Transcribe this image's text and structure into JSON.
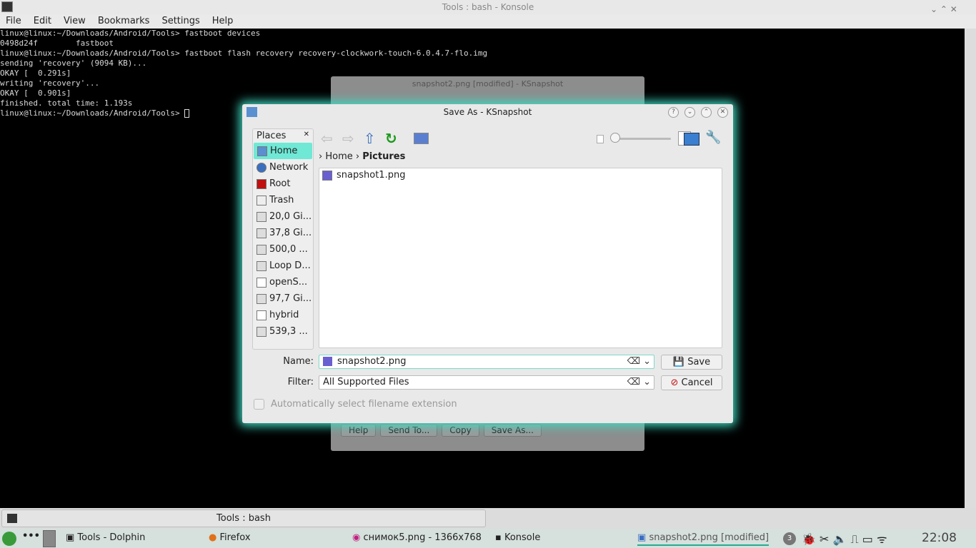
{
  "konsole": {
    "title": "Tools : bash - Konsole",
    "menu": [
      "File",
      "Edit",
      "View",
      "Bookmarks",
      "Settings",
      "Help"
    ],
    "lines": [
      "linux@linux:~/Downloads/Android/Tools> fastboot devices",
      "0498d24f        fastboot",
      "linux@linux:~/Downloads/Android/Tools> fastboot flash recovery recovery-clockwork-touch-6.0.4.7-flo.img",
      "sending 'recovery' (9094 KB)...",
      "OKAY [  0.291s]",
      "writing 'recovery'...",
      "OKAY [  0.901s]",
      "finished. total time: 1.193s",
      "linux@linux:~/Downloads/Android/Tools> "
    ],
    "tab_label": "Tools : bash"
  },
  "ksnapshot": {
    "title": "snapshot2.png [modified] - KSnapshot",
    "buttons": [
      "Help",
      "Send To...",
      "Copy",
      "Save As..."
    ]
  },
  "dialog": {
    "title": "Save As - KSnapshot",
    "places_header": "Places",
    "places": [
      "Home",
      "Network",
      "Root",
      "Trash",
      "20,0 Gi...",
      "37,8 Gi...",
      "500,0 ...",
      "Loop D...",
      "openS...",
      "97,7 Gi...",
      "hybrid",
      "539,3 ..."
    ],
    "breadcrumb": [
      "Home",
      "Pictures"
    ],
    "files": [
      "snapshot1.png"
    ],
    "name_label": "Name:",
    "name_value": "snapshot2.png",
    "filter_label": "Filter:",
    "filter_value": "All Supported Files",
    "save": "Save",
    "cancel": "Cancel",
    "auto_ext": "Automatically select filename extension"
  },
  "taskbar": {
    "tasks": [
      "Tools - Dolphin",
      "Firefox",
      "снимок5.png - 1366x768 -",
      "Konsole",
      "snapshot2.png [modified]"
    ],
    "badge": "3",
    "clock": "22:08"
  },
  "colors": {
    "accent": "#3fd9c0"
  }
}
